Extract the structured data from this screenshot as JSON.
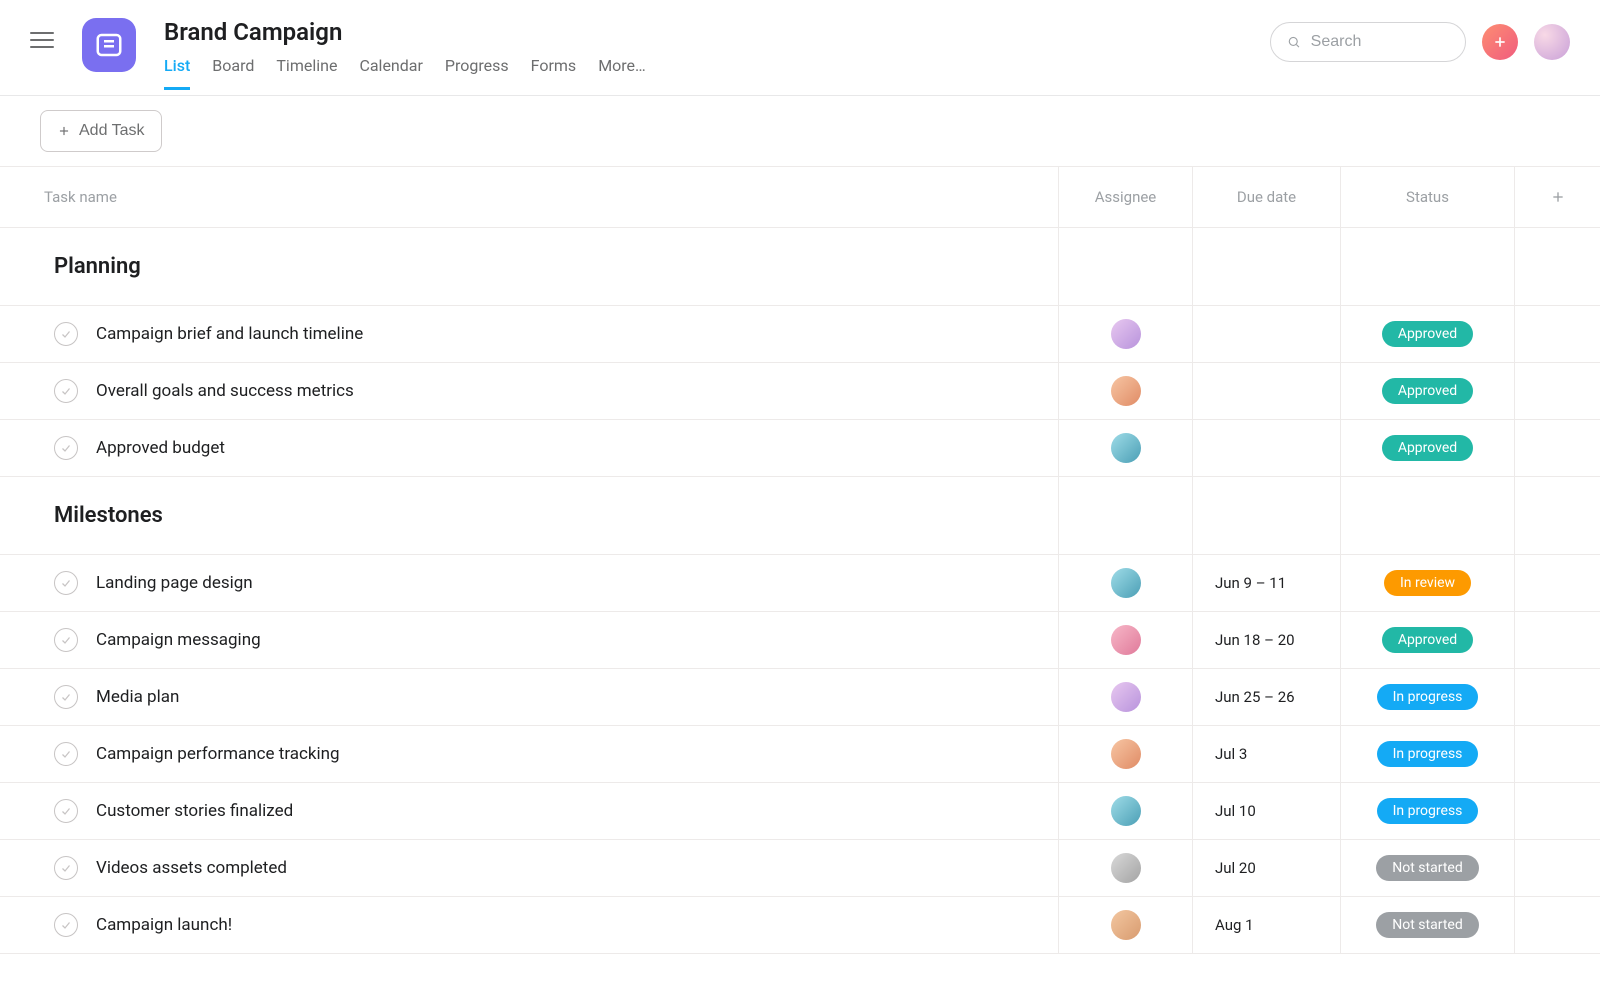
{
  "header": {
    "title": "Brand Campaign",
    "tabs": [
      "List",
      "Board",
      "Timeline",
      "Calendar",
      "Progress",
      "Forms",
      "More…"
    ],
    "active_tab_index": 0,
    "search_placeholder": "Search"
  },
  "toolbar": {
    "add_task_label": "Add Task"
  },
  "columns": {
    "task_name": "Task name",
    "assignee": "Assignee",
    "due_date": "Due date",
    "status": "Status"
  },
  "status_labels": {
    "approved": "Approved",
    "in_review": "In review",
    "in_progress": "In progress",
    "not_started": "Not started"
  },
  "sections": [
    {
      "name": "Planning",
      "tasks": [
        {
          "name": "Campaign brief and launch timeline",
          "assignee_color": "av1",
          "due": "",
          "status": "approved"
        },
        {
          "name": "Overall goals and success metrics",
          "assignee_color": "av2",
          "due": "",
          "status": "approved"
        },
        {
          "name": "Approved budget",
          "assignee_color": "av3",
          "due": "",
          "status": "approved"
        }
      ]
    },
    {
      "name": "Milestones",
      "tasks": [
        {
          "name": "Landing page design",
          "assignee_color": "av3",
          "due": "Jun 9 – 11",
          "status": "in_review"
        },
        {
          "name": "Campaign messaging",
          "assignee_color": "av4",
          "due": "Jun 18 – 20",
          "status": "approved"
        },
        {
          "name": "Media plan",
          "assignee_color": "av1",
          "due": "Jun 25 – 26",
          "status": "in_progress"
        },
        {
          "name": "Campaign performance tracking",
          "assignee_color": "av2",
          "due": "Jul 3",
          "status": "in_progress"
        },
        {
          "name": "Customer stories finalized",
          "assignee_color": "av3",
          "due": "Jul 10",
          "status": "in_progress"
        },
        {
          "name": "Videos assets completed",
          "assignee_color": "av5",
          "due": "Jul 20",
          "status": "not_started"
        },
        {
          "name": "Campaign launch!",
          "assignee_color": "av6",
          "due": "Aug 1",
          "status": "not_started"
        }
      ]
    }
  ]
}
